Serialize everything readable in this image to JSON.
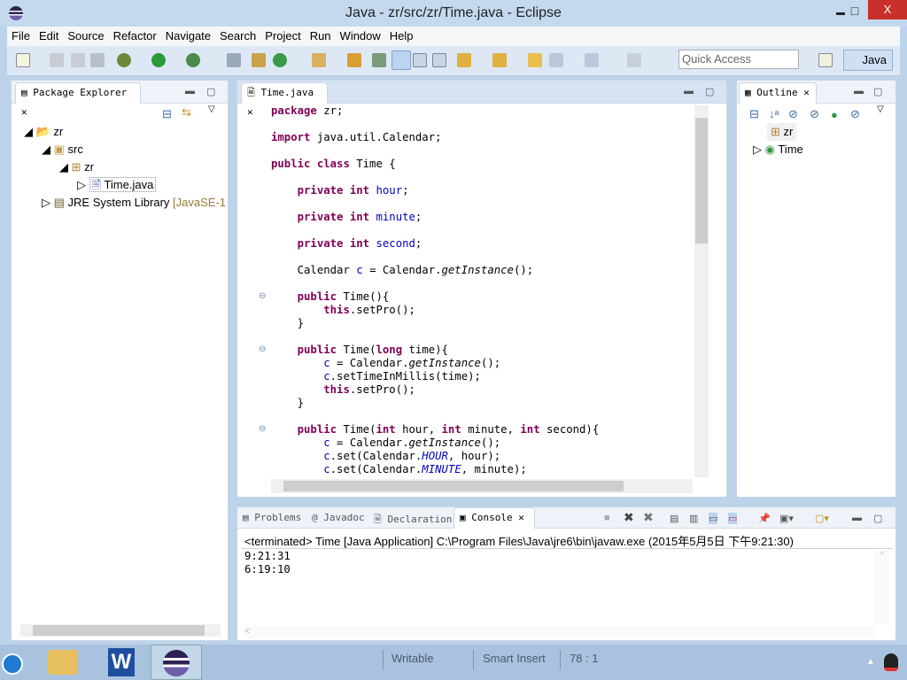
{
  "window": {
    "title": "Java - zr/src/zr/Time.java - Eclipse",
    "minimize": "▬",
    "maximize": "□",
    "close": "X"
  },
  "menu": [
    "File",
    "Edit",
    "Source",
    "Refactor",
    "Navigate",
    "Search",
    "Project",
    "Run",
    "Window",
    "Help"
  ],
  "toolbar": {
    "quick_access_placeholder": "Quick Access",
    "perspective": "Java"
  },
  "package_explorer": {
    "title": "Package Explorer",
    "tree": [
      {
        "label": "zr",
        "icon": "project-icon",
        "expanded": true
      },
      {
        "label": "src",
        "icon": "source-folder-icon",
        "expanded": true
      },
      {
        "label": "zr",
        "icon": "package-icon",
        "expanded": true
      },
      {
        "label": "Time.java",
        "icon": "java-file-icon",
        "selected": true
      },
      {
        "label": "JRE System Library",
        "suffix": "[JavaSE-1",
        "icon": "library-icon"
      }
    ]
  },
  "editor": {
    "tab": "Time.java",
    "lines": [
      [
        [
          "kw",
          "package"
        ],
        [
          "",
          "zr;"
        ]
      ],
      [],
      [
        [
          "kw",
          "import"
        ],
        [
          "",
          "java.util.Calendar;"
        ]
      ],
      [],
      [
        [
          "kw",
          "public"
        ],
        [
          "kw",
          "class"
        ],
        [
          "",
          "Time {"
        ]
      ],
      [],
      [
        [
          "",
          "    "
        ],
        [
          "kw",
          "private"
        ],
        [
          "kw",
          "int"
        ],
        [
          "fd",
          "hour"
        ],
        [
          "",
          ";"
        ]
      ],
      [],
      [
        [
          "",
          "    "
        ],
        [
          "kw",
          "private"
        ],
        [
          "kw",
          "int"
        ],
        [
          "fd",
          "minute"
        ],
        [
          "",
          ";"
        ]
      ],
      [],
      [
        [
          "",
          "    "
        ],
        [
          "kw",
          "private"
        ],
        [
          "kw",
          "int"
        ],
        [
          "fd",
          "second"
        ],
        [
          "",
          ";"
        ]
      ],
      [],
      [
        [
          "",
          "    Calendar"
        ],
        [
          "fd",
          "c"
        ],
        [
          "",
          "= Calendar."
        ],
        [
          "it",
          "getInstance"
        ],
        [
          "",
          "();"
        ]
      ],
      [],
      [
        [
          "",
          "    "
        ],
        [
          "kw",
          "public"
        ],
        [
          "",
          "Time(){"
        ]
      ],
      [
        [
          "",
          "        "
        ],
        [
          "kw",
          "this"
        ],
        [
          "",
          ".setPro();"
        ]
      ],
      [
        [
          "",
          "    }"
        ]
      ],
      [],
      [
        [
          "",
          "    "
        ],
        [
          "kw",
          "public"
        ],
        [
          "",
          "Time("
        ],
        [
          "kw",
          "long"
        ],
        [
          "",
          "time){"
        ]
      ],
      [
        [
          "",
          "        "
        ],
        [
          "fd",
          "c"
        ],
        [
          "",
          "= Calendar."
        ],
        [
          "it",
          "getInstance"
        ],
        [
          "",
          "();"
        ]
      ],
      [
        [
          "",
          "        "
        ],
        [
          "fd",
          "c"
        ],
        [
          "",
          ".setTimeInMillis(time);"
        ]
      ],
      [
        [
          "",
          "        "
        ],
        [
          "kw",
          "this"
        ],
        [
          "",
          ".setPro();"
        ]
      ],
      [
        [
          "",
          "    }"
        ]
      ],
      [],
      [
        [
          "",
          "    "
        ],
        [
          "kw",
          "public"
        ],
        [
          "",
          "Time("
        ],
        [
          "kw",
          "int"
        ],
        [
          "",
          "hour,"
        ],
        [
          "kw",
          "int"
        ],
        [
          "",
          "minute,"
        ],
        [
          "kw",
          "int"
        ],
        [
          "",
          "second){"
        ]
      ],
      [
        [
          "",
          "        "
        ],
        [
          "fd",
          "c"
        ],
        [
          "",
          "= Calendar."
        ],
        [
          "it",
          "getInstance"
        ],
        [
          "",
          "();"
        ]
      ],
      [
        [
          "",
          "        "
        ],
        [
          "fd",
          "c"
        ],
        [
          "",
          ".set(Calendar."
        ],
        [
          "sf",
          "HOUR"
        ],
        [
          "",
          ", hour);"
        ]
      ],
      [
        [
          "",
          "        "
        ],
        [
          "fd",
          "c"
        ],
        [
          "",
          ".set(Calendar."
        ],
        [
          "sf",
          "MINUTE"
        ],
        [
          "",
          ", minute);"
        ]
      ]
    ]
  },
  "outline": {
    "title": "Outline",
    "items": [
      {
        "label": "zr",
        "icon": "package-icon"
      },
      {
        "label": "Time",
        "icon": "class-icon"
      }
    ]
  },
  "bottom": {
    "tabs": [
      "Problems",
      "Javadoc",
      "Declaration",
      "Console"
    ],
    "active": "Console",
    "console_header": "<terminated> Time [Java Application] C:\\Program Files\\Java\\jre6\\bin\\javaw.exe (2015年5月5日 下午9:21:30)",
    "output": [
      "9:21:31",
      "6:19:10"
    ]
  },
  "status": {
    "writable": "Writable",
    "insert_mode": "Smart Insert",
    "position": "78 : 1"
  }
}
